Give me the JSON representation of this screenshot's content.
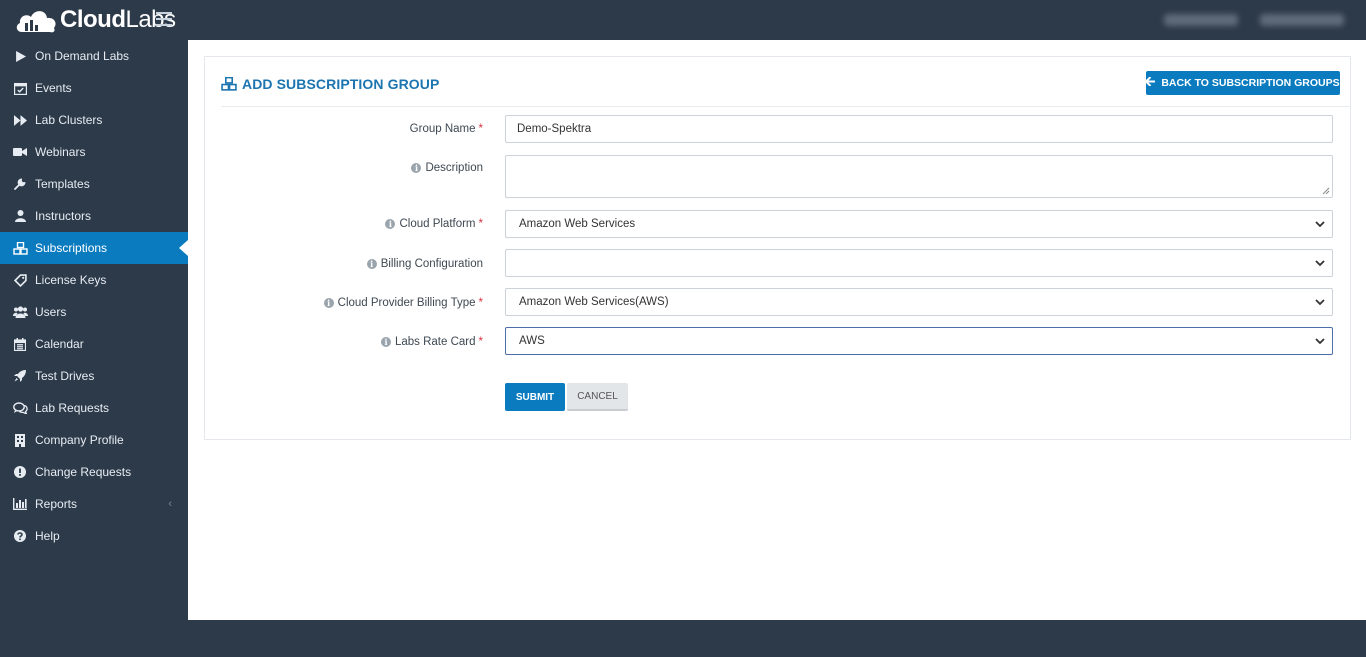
{
  "app": {
    "logo_bold": "Cloud",
    "logo_light": "Labs"
  },
  "sidebar": {
    "items": [
      {
        "label": "On Demand Labs",
        "icon": "play-icon"
      },
      {
        "label": "Events",
        "icon": "calendar-check-icon"
      },
      {
        "label": "Lab Clusters",
        "icon": "fast-forward-icon"
      },
      {
        "label": "Webinars",
        "icon": "video-camera-icon"
      },
      {
        "label": "Templates",
        "icon": "wrench-icon"
      },
      {
        "label": "Instructors",
        "icon": "user-icon"
      },
      {
        "label": "Subscriptions",
        "icon": "cubes-icon",
        "active": true
      },
      {
        "label": "License Keys",
        "icon": "tag-icon"
      },
      {
        "label": "Users",
        "icon": "users-icon"
      },
      {
        "label": "Calendar",
        "icon": "calendar-icon"
      },
      {
        "label": "Test Drives",
        "icon": "rocket-icon"
      },
      {
        "label": "Lab Requests",
        "icon": "comments-icon"
      },
      {
        "label": "Company Profile",
        "icon": "building-icon"
      },
      {
        "label": "Change Requests",
        "icon": "exclamation-circle-icon"
      },
      {
        "label": "Reports",
        "icon": "bar-chart-icon",
        "chevron": "‹"
      },
      {
        "label": "Help",
        "icon": "question-circle-icon"
      }
    ]
  },
  "page": {
    "title": "ADD SUBSCRIPTION GROUP",
    "back_button": "BACK TO SUBSCRIPTION GROUPS"
  },
  "form": {
    "group_name": {
      "label": "Group Name",
      "value": "Demo-Spektra",
      "required": "*"
    },
    "description": {
      "label": "Description",
      "value": ""
    },
    "cloud_platform": {
      "label": "Cloud Platform",
      "value": "Amazon Web Services",
      "required": "*"
    },
    "billing_configuration": {
      "label": "Billing Configuration",
      "value": ""
    },
    "cloud_provider_billing_type": {
      "label": "Cloud Provider Billing Type",
      "value": "Amazon Web Services(AWS)",
      "required": "*"
    },
    "labs_rate_card": {
      "label": "Labs Rate Card",
      "value": "AWS",
      "required": "*"
    },
    "submit_label": "SUBMIT",
    "cancel_label": "CANCEL"
  },
  "colors": {
    "sidebar_bg": "#2d3a4a",
    "accent": "#0a7bbf",
    "title_blue": "#1c74b0",
    "required_red": "#d9333f"
  }
}
